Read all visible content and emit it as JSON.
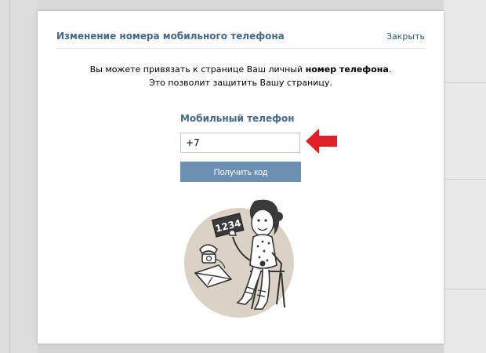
{
  "modal": {
    "title": "Изменение номера мобильного телефона",
    "close_label": "Закрыть",
    "desc_line1_prefix": "Вы можете привязать к странице Ваш личный ",
    "desc_line1_bold": "номер телефона",
    "desc_line1_suffix": ".",
    "desc_line2": "Это позволит защитить Вашу страницу."
  },
  "phone_field": {
    "label": "Мобильный телефон",
    "value": "+7"
  },
  "get_code_button": {
    "label": "Получить код"
  },
  "illustration": {
    "sign_text": "1234"
  },
  "colors": {
    "accent": "#45688e",
    "button": "#6d8fb3",
    "arrow": "#e21f26",
    "illustration_bg": "#d9d2c5"
  }
}
